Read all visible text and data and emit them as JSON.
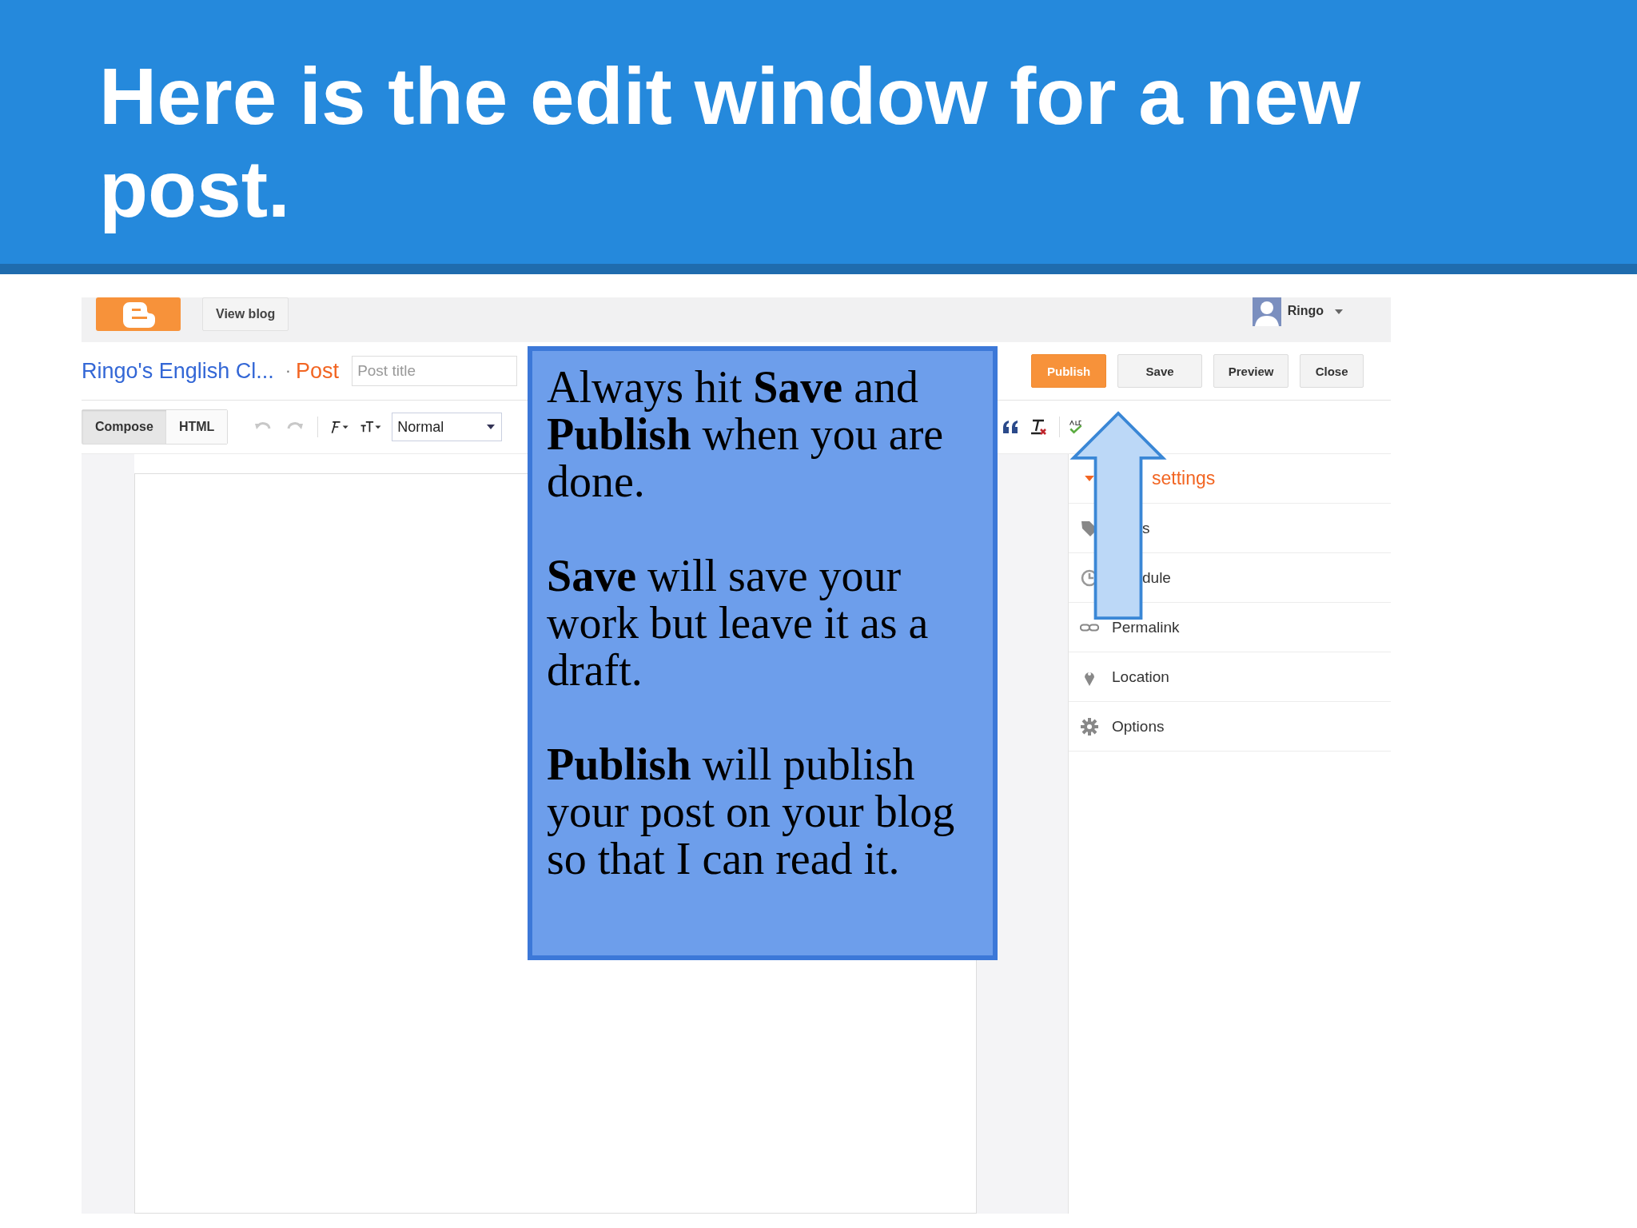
{
  "slide_title": "Here is the edit window for a new post.",
  "top_bar": {
    "view_blog": "View blog",
    "user": "Ringo"
  },
  "post_bar": {
    "blog_name": "Ringo's English Cl...",
    "separator": "·",
    "section": "Post",
    "title_placeholder": "Post title",
    "buttons": [
      {
        "label": "Publish",
        "kind": "primary"
      },
      {
        "label": "Save",
        "kind": "plain"
      },
      {
        "label": "Preview",
        "kind": "plain"
      },
      {
        "label": "Close",
        "kind": "plain"
      }
    ]
  },
  "toolbar": {
    "modes": [
      {
        "label": "Compose",
        "selected": true
      },
      {
        "label": "HTML",
        "selected": false
      }
    ],
    "format": "Normal"
  },
  "sidebar": {
    "items": [
      {
        "label": "settings",
        "kind": "section"
      },
      {
        "label": "s",
        "kind": "partial"
      },
      {
        "label": "dule",
        "kind": "partial"
      },
      {
        "label": "Permalink",
        "kind": "item"
      },
      {
        "label": "Location",
        "kind": "item"
      },
      {
        "label": "Options",
        "kind": "item"
      }
    ]
  },
  "callout": {
    "paragraphs": [
      "Always hit **Save** and **Publish** when you are done.",
      "**Save** will save your work but leave it as a draft.",
      "**Publish** will publish your post on your blog so that I can read it."
    ]
  }
}
